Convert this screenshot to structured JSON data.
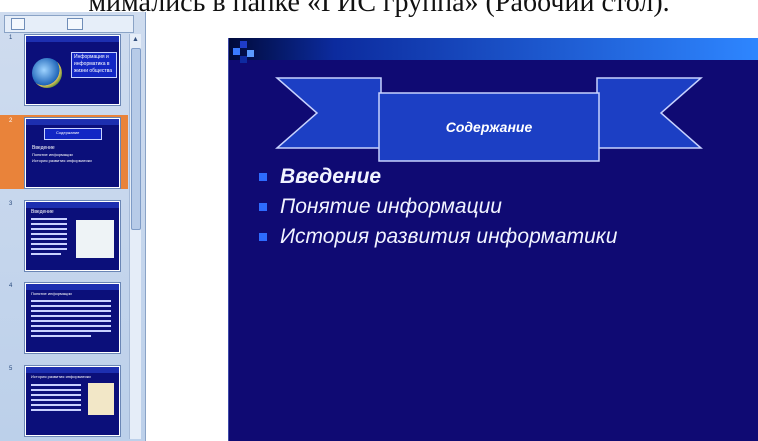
{
  "caption": {
    "text": "мимались в папке «ГИС группа» (Рабочий стол)."
  },
  "pane": {
    "thumbnails": [
      {
        "number": "1",
        "title_lines": [
          "Информация и",
          "информатика в",
          "жизни общества"
        ]
      },
      {
        "number": "2",
        "heading": "Содержание",
        "items": [
          "Введение",
          "Понятие информации",
          "История развития информатики"
        ]
      },
      {
        "number": "3",
        "heading": "Введение"
      },
      {
        "number": "4",
        "heading": "Понятие информации"
      },
      {
        "number": "5",
        "heading": "История развития информатики"
      }
    ]
  },
  "slide": {
    "title": "Содержание",
    "bullets": [
      "Введение",
      "Понятие информации",
      "История развития информатики"
    ]
  },
  "colors": {
    "slide_bg": "#0f0a73",
    "ribbon": "#1c3fc4",
    "bullet": "#2d6bff",
    "selection": "#e9833a"
  },
  "icons": {
    "tab_outline": "outline-tab-icon",
    "tab_slides": "slides-tab-icon",
    "scroll_up": "scroll-up-arrow-icon"
  }
}
